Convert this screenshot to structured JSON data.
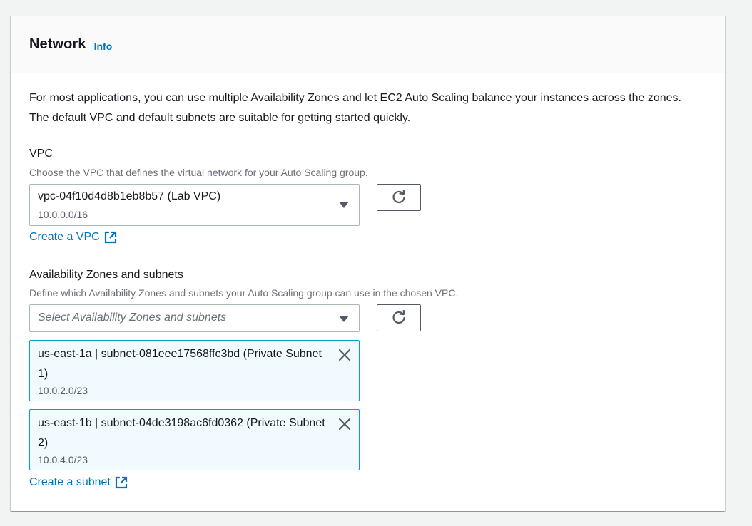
{
  "header": {
    "title": "Network",
    "info_label": "Info"
  },
  "intro": "For most applications, you can use multiple Availability Zones and let EC2 Auto Scaling balance your instances across the zones. The default VPC and default subnets are suitable for getting started quickly.",
  "vpc": {
    "label": "VPC",
    "description": "Choose the VPC that defines the virtual network for your Auto Scaling group.",
    "selected_value": "vpc-04f10d4d8b1eb8b57 (Lab VPC)",
    "selected_cidr": "10.0.0.0/16",
    "create_link": "Create a VPC"
  },
  "subnets": {
    "label": "Availability Zones and subnets",
    "description": "Define which Availability Zones and subnets your Auto Scaling group can use in the chosen VPC.",
    "placeholder": "Select Availability Zones and subnets",
    "tokens": [
      {
        "label": "us-east-1a | subnet-081eee17568ffc3bd (Private Subnet 1)",
        "cidr": "10.0.2.0/23"
      },
      {
        "label": "us-east-1b | subnet-04de3198ac6fd0362 (Private Subnet 2)",
        "cidr": "10.0.4.0/23"
      }
    ],
    "create_link": "Create a subnet"
  },
  "icons": {
    "refresh": "refresh-icon",
    "external": "external-link-icon",
    "dismiss": "close-icon",
    "caret": "caret-down-icon"
  },
  "colors": {
    "link": "#0073bb",
    "token_bg": "#f1faff",
    "token_border": "#00a1c9"
  }
}
